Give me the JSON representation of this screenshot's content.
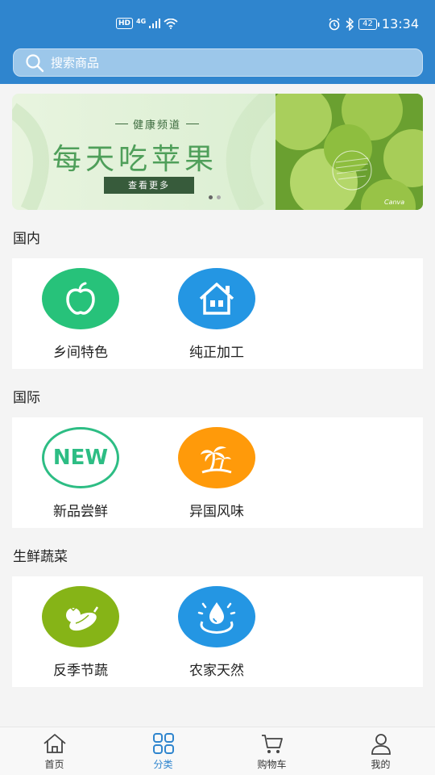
{
  "status_bar": {
    "network_badge": "HD",
    "network_type": "4G",
    "battery": "42",
    "time": "13:34"
  },
  "search": {
    "placeholder": "搜索商品"
  },
  "banner": {
    "channel": "健康频道",
    "title": "每天吃苹果",
    "button_label": "查看更多",
    "slide_count": 2,
    "active_slide": 0
  },
  "sections": [
    {
      "title": "国内",
      "items": [
        {
          "label": "乡间特色",
          "icon": "apple-icon",
          "color": "#27c27a"
        },
        {
          "label": "纯正加工",
          "icon": "house-icon",
          "color": "#2496e3"
        }
      ]
    },
    {
      "title": "国际",
      "items": [
        {
          "label": "新品尝鲜",
          "icon": "new-badge-icon",
          "color": "#2dbd84"
        },
        {
          "label": "异国风味",
          "icon": "palm-tree-icon",
          "color": "#ff9a0a"
        }
      ]
    },
    {
      "title": "生鲜蔬菜",
      "items": [
        {
          "label": "反季节蔬",
          "icon": "vegetables-icon",
          "color": "#86b417"
        },
        {
          "label": "农家天然",
          "icon": "water-drop-icon",
          "color": "#2496e3"
        }
      ]
    }
  ],
  "tabbar": {
    "items": [
      {
        "label": "首页",
        "icon": "home-icon"
      },
      {
        "label": "分类",
        "icon": "grid-icon",
        "active": true
      },
      {
        "label": "购物车",
        "icon": "cart-icon"
      },
      {
        "label": "我的",
        "icon": "user-icon"
      }
    ]
  }
}
